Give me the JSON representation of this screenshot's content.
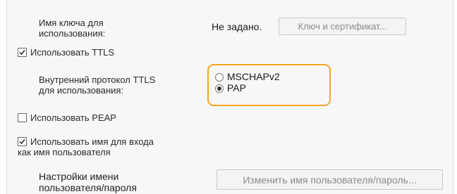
{
  "key_usage": {
    "label_line1": "Имя ключа для",
    "label_line2": "использования:",
    "value": "Не задано.",
    "button_label": "Ключ и сертификат..."
  },
  "use_ttls": {
    "label": "Использовать TTLS",
    "checked": true
  },
  "ttls_protocol": {
    "label_line1": "Внутренний протокол TTLS",
    "label_line2": "для использования:",
    "options": [
      {
        "label": "MSCHAPv2",
        "selected": false
      },
      {
        "label": "PAP",
        "selected": true
      }
    ],
    "highlight_color": "#f5a623"
  },
  "use_peap": {
    "label": "Использовать PEAP",
    "checked": false
  },
  "use_login_name": {
    "label_line1": "Использовать имя для входа",
    "label_line2": "как имя пользователя",
    "checked": true
  },
  "username_settings": {
    "label_line1": "Настройки имени",
    "label_line2": "пользователя/пароля",
    "button_label": "Изменить имя пользователя/пароль..."
  }
}
